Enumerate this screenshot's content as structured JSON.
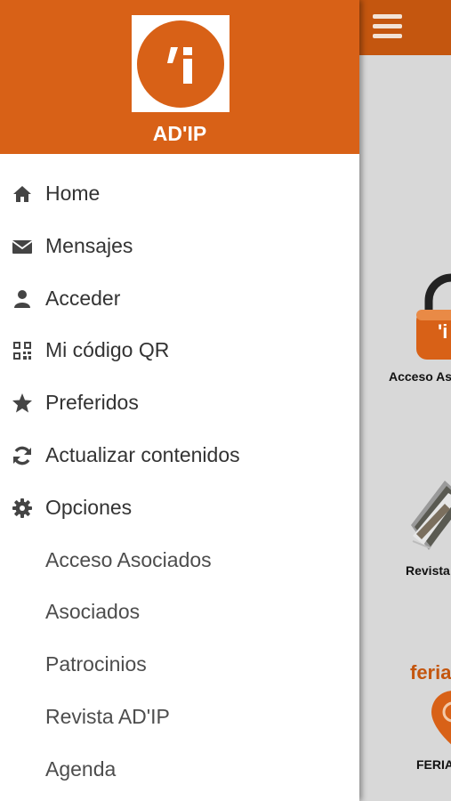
{
  "header": {
    "app_name": "AD'IP",
    "logo_glyph": "'i"
  },
  "menu": {
    "items": [
      {
        "label": "Home",
        "icon": "home-icon"
      },
      {
        "label": "Mensajes",
        "icon": "envelope-icon"
      },
      {
        "label": "Acceder",
        "icon": "user-icon"
      },
      {
        "label": "Mi código QR",
        "icon": "qrcode-icon"
      },
      {
        "label": "Preferidos",
        "icon": "star-icon"
      },
      {
        "label": "Actualizar contenidos",
        "icon": "refresh-icon"
      },
      {
        "label": "Opciones",
        "icon": "gear-icon"
      }
    ],
    "sub_items": [
      {
        "label": "Acceso Asociados"
      },
      {
        "label": "Asociados"
      },
      {
        "label": "Patrocinios"
      },
      {
        "label": "Revista AD'IP"
      },
      {
        "label": "Agenda"
      }
    ]
  },
  "main": {
    "tiles": [
      {
        "label": "Acceso Asociados",
        "icon": "lock-icon"
      },
      {
        "label": "Revista AD'IP",
        "icon": "magazine-icon"
      },
      {
        "label": "FERIAS",
        "icon": "map-pin-icon",
        "brand_text": "feria"
      }
    ]
  },
  "colors": {
    "brand": "#d86117",
    "topbar": "#c4560f",
    "background": "#d8d8d8"
  }
}
